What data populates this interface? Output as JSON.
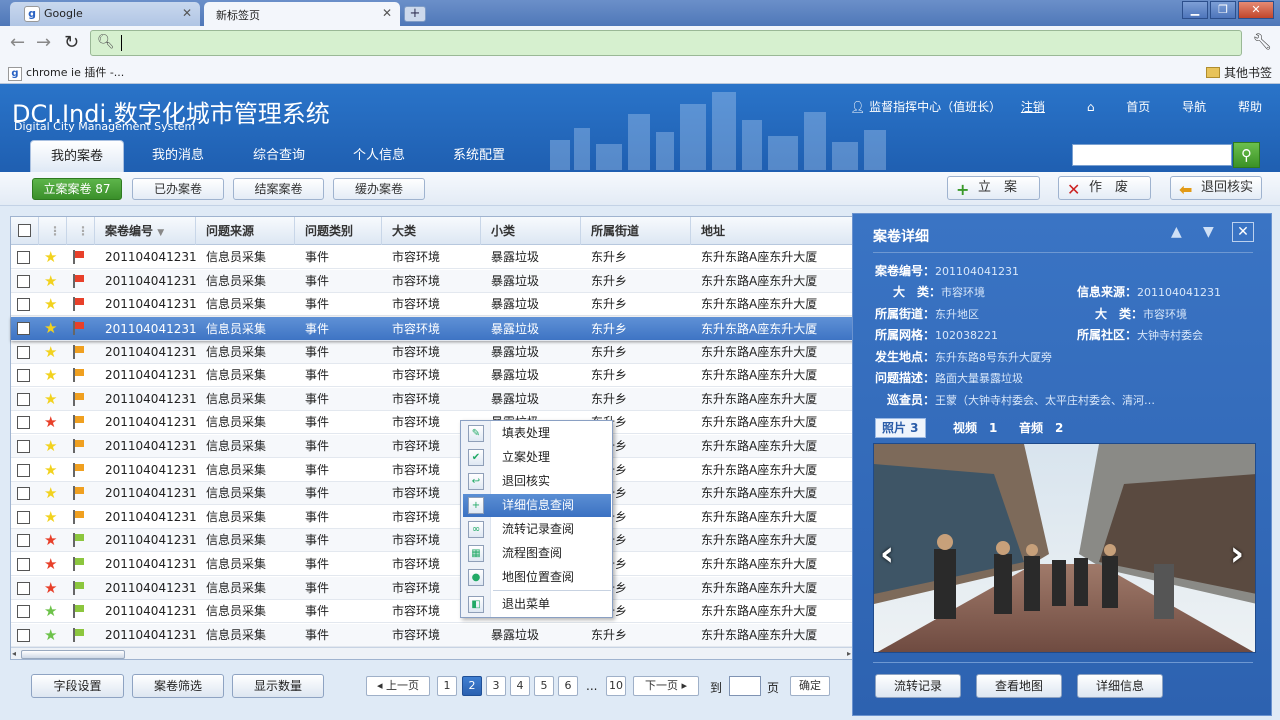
{
  "browser": {
    "tabs": [
      {
        "label": "Google"
      },
      {
        "label": "新标签页"
      }
    ],
    "bookmarks": {
      "left": "chrome ie 插件 -...",
      "right": "其他书签"
    }
  },
  "header": {
    "logo": "DCI.Indi.数字化城市管理系统",
    "logo_sub": "Digital City Management System",
    "user": "监督指挥中心（值班长）",
    "logout": "注销",
    "links": [
      "首页",
      "导航",
      "帮助"
    ],
    "tabs": [
      "我的案卷",
      "我的消息",
      "综合查询",
      "个人信息",
      "系统配置"
    ]
  },
  "subbar": {
    "filters": [
      {
        "label": "立案案卷 87"
      },
      {
        "label": "已办案卷"
      },
      {
        "label": "结案案卷"
      },
      {
        "label": "缓办案卷"
      }
    ],
    "actions": [
      {
        "label": "立　案",
        "icon": "+",
        "color": "#3a9a2a"
      },
      {
        "label": "作　废",
        "icon": "✕",
        "color": "#cc2222"
      },
      {
        "label": "退回核实",
        "icon": "⬅",
        "color": "#e29a16"
      }
    ]
  },
  "grid": {
    "headers": [
      "案卷编号",
      "问题来源",
      "问题类别",
      "大类",
      "小类",
      "所属街道",
      "地址"
    ],
    "sort_icon": "▼",
    "rows": [
      {
        "id": "201104041231",
        "source": "信息员采集",
        "type": "事件",
        "big": "市容环境",
        "small": "暴露垃圾",
        "street": "东升乡",
        "addr": "东升东路A座东升大厦",
        "star": "#f2d21e",
        "flag": "#e8402a"
      },
      {
        "id": "201104041231",
        "source": "信息员采集",
        "type": "事件",
        "big": "市容环境",
        "small": "暴露垃圾",
        "street": "东升乡",
        "addr": "东升东路A座东升大厦",
        "star": "#f2d21e",
        "flag": "#e8402a"
      },
      {
        "id": "201104041231",
        "source": "信息员采集",
        "type": "事件",
        "big": "市容环境",
        "small": "暴露垃圾",
        "street": "东升乡",
        "addr": "东升东路A座东升大厦",
        "star": "#f2d21e",
        "flag": "#e8402a"
      },
      {
        "id": "201104041231",
        "source": "信息员采集",
        "type": "事件",
        "big": "市容环境",
        "small": "暴露垃圾",
        "street": "东升乡",
        "addr": "东升东路A座东升大厦",
        "star": "#f2d21e",
        "flag": "#e8402a"
      },
      {
        "id": "201104041231",
        "source": "信息员采集",
        "type": "事件",
        "big": "市容环境",
        "small": "暴露垃圾",
        "street": "东升乡",
        "addr": "东升东路A座东升大厦",
        "star": "#f2d21e",
        "flag": "#f0a020"
      },
      {
        "id": "201104041231",
        "source": "信息员采集",
        "type": "事件",
        "big": "市容环境",
        "small": "暴露垃圾",
        "street": "东升乡",
        "addr": "东升东路A座东升大厦",
        "star": "#f2d21e",
        "flag": "#f0a020"
      },
      {
        "id": "201104041231",
        "source": "信息员采集",
        "type": "事件",
        "big": "市容环境",
        "small": "暴露垃圾",
        "street": "东升乡",
        "addr": "东升东路A座东升大厦",
        "star": "#f2d21e",
        "flag": "#f0a020"
      },
      {
        "id": "201104041231",
        "source": "信息员采集",
        "type": "事件",
        "big": "市容环境",
        "small": "暴露垃圾",
        "street": "东升乡",
        "addr": "东升东路A座东升大厦",
        "star": "#e8402a",
        "flag": "#f0a020"
      },
      {
        "id": "201104041231",
        "source": "信息员采集",
        "type": "事件",
        "big": "市容环境",
        "small": "暴露垃圾",
        "street": "东升乡",
        "addr": "东升东路A座东升大厦",
        "star": "#f2d21e",
        "flag": "#f0a020"
      },
      {
        "id": "201104041231",
        "source": "信息员采集",
        "type": "事件",
        "big": "市容环境",
        "small": "暴露垃圾",
        "street": "东升乡",
        "addr": "东升东路A座东升大厦",
        "star": "#f2d21e",
        "flag": "#f0a020"
      },
      {
        "id": "201104041231",
        "source": "信息员采集",
        "type": "事件",
        "big": "市容环境",
        "small": "暴露垃圾",
        "street": "东升乡",
        "addr": "东升东路A座东升大厦",
        "star": "#f2d21e",
        "flag": "#f0a020"
      },
      {
        "id": "201104041231",
        "source": "信息员采集",
        "type": "事件",
        "big": "市容环境",
        "small": "暴露垃圾",
        "street": "东升乡",
        "addr": "东升东路A座东升大厦",
        "star": "#f2d21e",
        "flag": "#f0a020"
      },
      {
        "id": "201104041231",
        "source": "信息员采集",
        "type": "事件",
        "big": "市容环境",
        "small": "暴露垃圾",
        "street": "东升乡",
        "addr": "东升东路A座东升大厦",
        "star": "#e8402a",
        "flag": "#8cc63e"
      },
      {
        "id": "201104041231",
        "source": "信息员采集",
        "type": "事件",
        "big": "市容环境",
        "small": "暴露垃圾",
        "street": "东升乡",
        "addr": "东升东路A座东升大厦",
        "star": "#e8402a",
        "flag": "#8cc63e"
      },
      {
        "id": "201104041231",
        "source": "信息员采集",
        "type": "事件",
        "big": "市容环境",
        "small": "暴露垃圾",
        "street": "东升乡",
        "addr": "东升东路A座东升大厦",
        "star": "#e8402a",
        "flag": "#8cc63e"
      },
      {
        "id": "201104041231",
        "source": "信息员采集",
        "type": "事件",
        "big": "市容环境",
        "small": "暴露垃圾",
        "street": "东升乡",
        "addr": "东升东路A座东升大厦",
        "star": "#6dc24a",
        "flag": "#8cc63e"
      },
      {
        "id": "201104041231",
        "source": "信息员采集",
        "type": "事件",
        "big": "市容环境",
        "small": "暴露垃圾",
        "street": "东升乡",
        "addr": "东升东路A座东升大厦",
        "star": "#6dc24a",
        "flag": "#8cc63e"
      }
    ],
    "selected_row": {
      "id": "201104041231",
      "source": "信息员采集",
      "type": "事件",
      "big": "市容环境",
      "small": "暴露垃圾",
      "street": "东升乡",
      "addr": "东升东路A座东升大厦",
      "star": "#f2d21e",
      "flag": "#e8402a"
    }
  },
  "context_menu": [
    {
      "label": "填表处理",
      "icon": "✎"
    },
    {
      "label": "立案处理",
      "icon": "✔"
    },
    {
      "label": "退回核实",
      "icon": "↩"
    },
    {
      "label": "详细信息查阅",
      "icon": "+"
    },
    {
      "label": "流转记录查阅",
      "icon": "∞"
    },
    {
      "label": "流程图查阅",
      "icon": "▦"
    },
    {
      "label": "地图位置查阅",
      "icon": "●"
    },
    {
      "label": "退出菜单",
      "icon": "◧"
    }
  ],
  "bottom": {
    "buttons": [
      "字段设置",
      "案卷筛选",
      "显示数量"
    ],
    "prev": "◂ 上一页",
    "next": "下一页 ▸",
    "pages": [
      "1",
      "2",
      "3",
      "4",
      "5",
      "6"
    ],
    "current_page": "2",
    "ellipsis": "...",
    "last": "10",
    "goto": "到",
    "page_unit": "页",
    "confirm": "确定"
  },
  "panel": {
    "title": "案卷详细",
    "fields": {
      "id_k": "案卷编号：",
      "id_v": "201104041231",
      "big_k": "大　类：",
      "big_v": "市容环境",
      "src_k": "信息来源：",
      "src_v": "201104041231",
      "street_k": "所属街道：",
      "street_v": "东升地区",
      "big2_k": "大　类：",
      "big2_v": "市容环境",
      "grid_k": "所属网格：",
      "grid_v": "102038221",
      "comm_k": "所属社区：",
      "comm_v": "大钟寺村委会",
      "place_k": "发生地点：",
      "place_v": "东升东路8号东升大厦旁",
      "desc_k": "问题描述：",
      "desc_v": "路面大量暴露垃圾",
      "insp_k": "巡查员：",
      "insp_v": "王蒙（大钟寺村委会、太平庄村委会、清河…"
    },
    "media_tabs": [
      "照片 3",
      "视频　1",
      "音频　2"
    ],
    "buttons": [
      "流转记录",
      "查看地图",
      "详细信息"
    ]
  }
}
